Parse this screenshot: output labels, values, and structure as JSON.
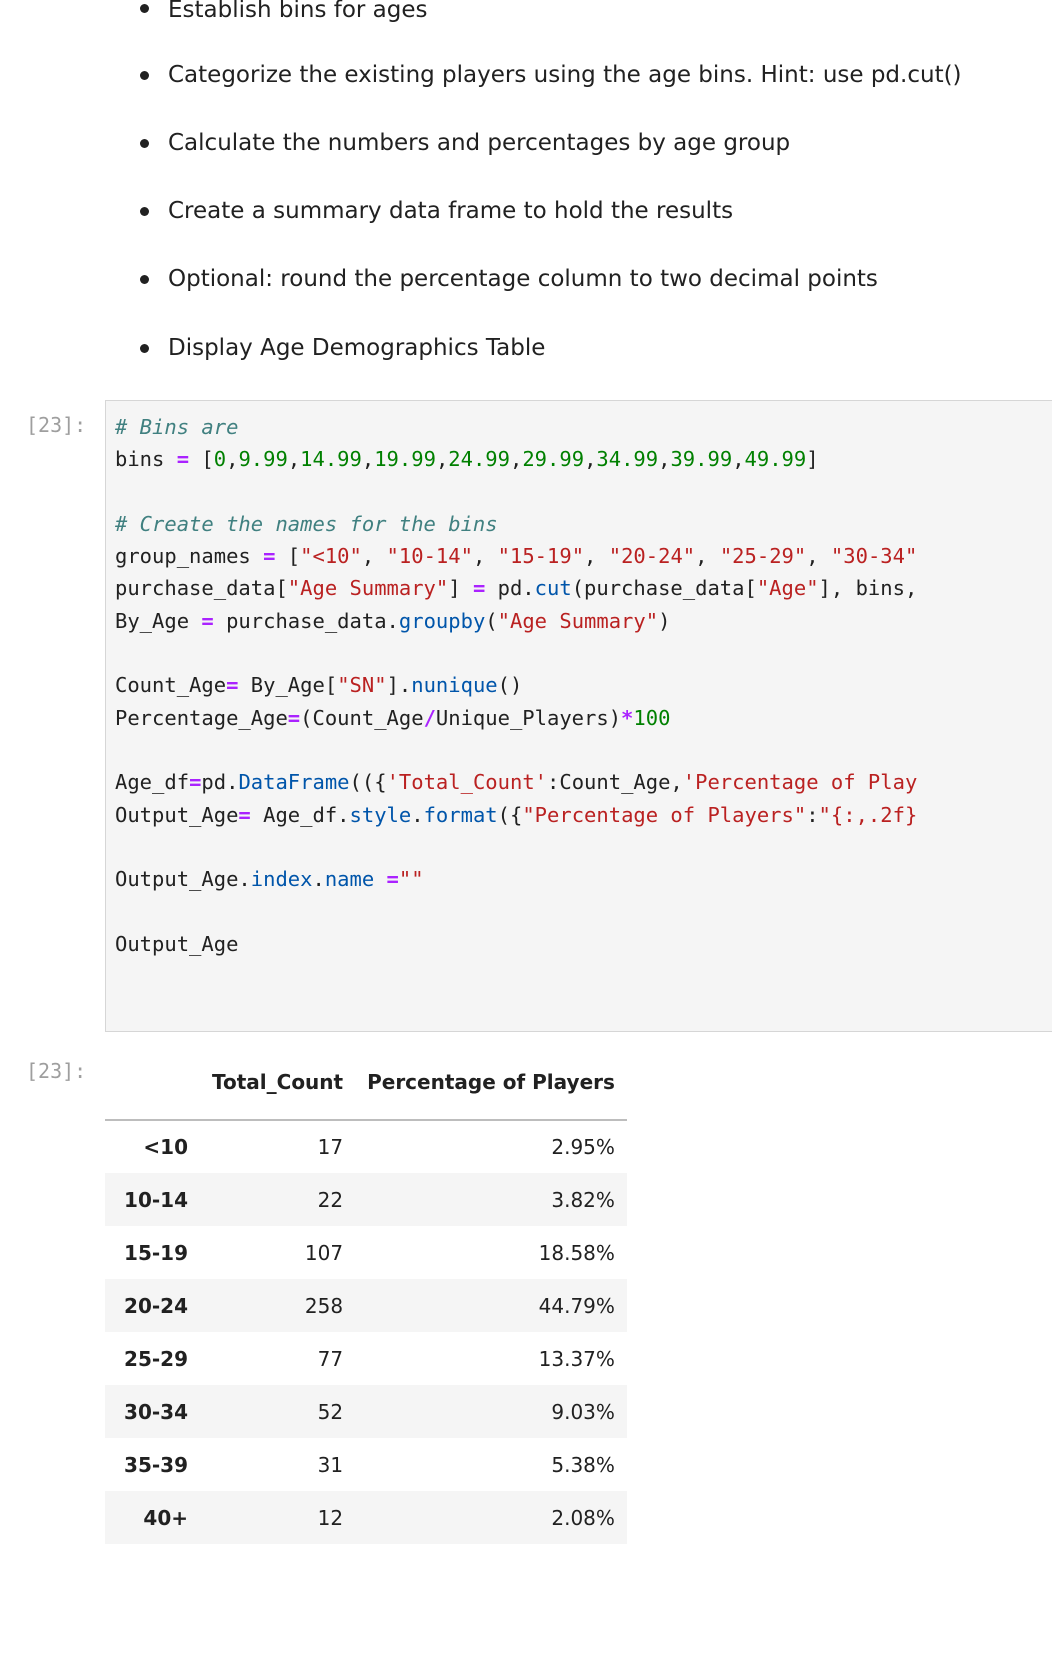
{
  "instructions": {
    "bullets": [
      "Establish bins for ages",
      "Categorize the existing players using the age bins. Hint: use pd.cut()",
      "Calculate the numbers and percentages by age group",
      "Create a summary data frame to hold the results",
      "Optional: round the percentage column to two decimal points",
      "Display Age Demographics Table"
    ]
  },
  "cell": {
    "input_prompt": "[23]:",
    "output_prompt": "[23]:"
  },
  "code": {
    "comment1": "# Bins are",
    "line_bins_name": "bins",
    "line_bins_values": [
      "0",
      "9.99",
      "14.99",
      "19.99",
      "24.99",
      "29.99",
      "34.99",
      "39.99",
      "49.99"
    ],
    "comment2": "# Create the names for the bins",
    "group_names": [
      "<10",
      "10-14",
      "15-19",
      "20-24",
      "25-29",
      "30-34"
    ],
    "line_cut_a": "purchase_data[",
    "line_cut_str1": "\"Age Summary\"",
    "line_cut_b": "] ",
    "line_cut_c": " pd.",
    "line_cut_fn": "cut",
    "line_cut_d": "(purchase_data[",
    "line_cut_str2": "\"Age\"",
    "line_cut_e": "], bins,",
    "line_groupby_a": "By_Age ",
    "line_groupby_b": " purchase_data.",
    "line_groupby_fn": "groupby",
    "line_groupby_str": "\"Age Summary\"",
    "line_count_a": "Count_Age",
    "line_count_b": " By_Age[",
    "line_count_str": "\"SN\"",
    "line_count_c": "].",
    "line_count_fn": "nunique",
    "line_count_d": "()",
    "line_pct_a": "Percentage_Age",
    "line_pct_b": "(Count_Age",
    "line_pct_c": "Unique_Players)",
    "line_pct_num": "100",
    "line_df_a": "Age_df",
    "line_df_b": "pd.",
    "line_df_fn": "DataFrame",
    "line_df_c": "(({",
    "line_df_str1": "'Total_Count'",
    "line_df_d": ":Count_Age,",
    "line_df_str2": "'Percentage of Play",
    "line_out_a": "Output_Age",
    "line_out_b": " Age_df.",
    "line_out_fn1": "style",
    "line_out_c": ".",
    "line_out_fn2": "format",
    "line_out_d": "({",
    "line_out_str1": "\"Percentage of Players\"",
    "line_out_e": ":",
    "line_out_str2": "\"{:,.2f}",
    "line_idx_a": "Output_Age.",
    "line_idx_fn1": "index",
    "line_idx_b": ".",
    "line_idx_fn2": "name",
    "line_idx_str": "\"\"",
    "line_last": "Output_Age"
  },
  "table": {
    "columns": [
      "",
      "Total_Count",
      "Percentage of Players"
    ],
    "rows": [
      {
        "index": "<10",
        "count": "17",
        "pct": "2.95%"
      },
      {
        "index": "10-14",
        "count": "22",
        "pct": "3.82%"
      },
      {
        "index": "15-19",
        "count": "107",
        "pct": "18.58%"
      },
      {
        "index": "20-24",
        "count": "258",
        "pct": "44.79%"
      },
      {
        "index": "25-29",
        "count": "77",
        "pct": "13.37%"
      },
      {
        "index": "30-34",
        "count": "52",
        "pct": "9.03%"
      },
      {
        "index": "35-39",
        "count": "31",
        "pct": "5.38%"
      },
      {
        "index": "40+",
        "count": "12",
        "pct": "2.08%"
      }
    ]
  }
}
